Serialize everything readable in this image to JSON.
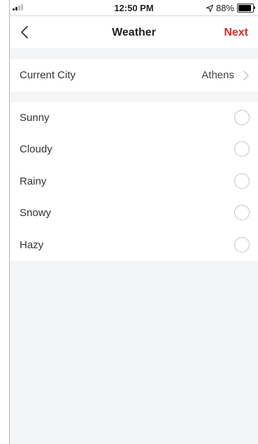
{
  "status_bar": {
    "time": "12:50 PM",
    "battery_text": "88%",
    "battery_level": 0.88,
    "icons": [
      "signal-icon",
      "location-arrow-icon",
      "battery-icon"
    ]
  },
  "nav": {
    "title": "Weather",
    "next_label": "Next",
    "accent_color": "#d0312d",
    "back_icon": "chevron-left-icon"
  },
  "city": {
    "label": "Current City",
    "value": "Athens",
    "icon": "chevron-right-icon"
  },
  "weather_options": [
    {
      "label": "Sunny",
      "selected": false
    },
    {
      "label": "Cloudy",
      "selected": false
    },
    {
      "label": "Rainy",
      "selected": false
    },
    {
      "label": "Snowy",
      "selected": false
    },
    {
      "label": "Hazy",
      "selected": false
    }
  ],
  "colors": {
    "background": "#f4f5f6",
    "surface": "#ffffff",
    "radio_border": "#c4c4c4"
  }
}
